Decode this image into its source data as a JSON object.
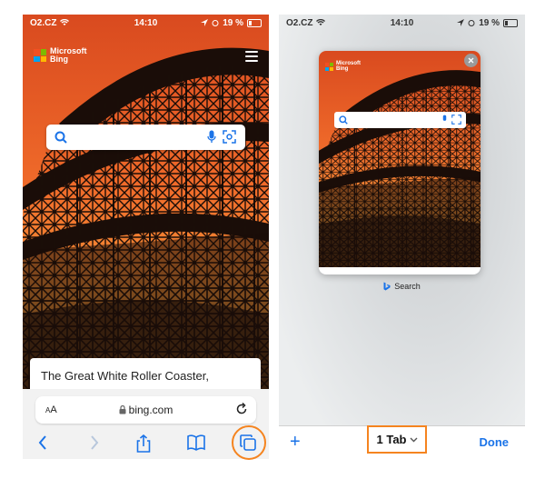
{
  "status_bar": {
    "carrier": "O2.CZ",
    "time": "14:10",
    "battery": "19 %"
  },
  "left_screen": {
    "logo_text_line1": "Microsoft",
    "logo_text_line2": "Bing",
    "card_text": "The Great White Roller Coaster,",
    "address": {
      "text_size_label_small": "A",
      "text_size_label_large": "A",
      "url": "bing.com"
    },
    "toolbar_icons": [
      "back-icon",
      "forward-icon",
      "share-icon",
      "bookmarks-icon",
      "tabs-icon"
    ]
  },
  "right_screen": {
    "thumbnail_logo_line1": "Microsoft",
    "thumbnail_logo_line2": "Bing",
    "tab_title": "Search",
    "tab_count_label": "1 Tab",
    "done_label": "Done",
    "new_tab_label": "+"
  },
  "colors": {
    "highlight": "#f5841f",
    "accent": "#1a73e8",
    "sky_top": "#e8542a",
    "sky_bottom": "#f7a43d"
  }
}
